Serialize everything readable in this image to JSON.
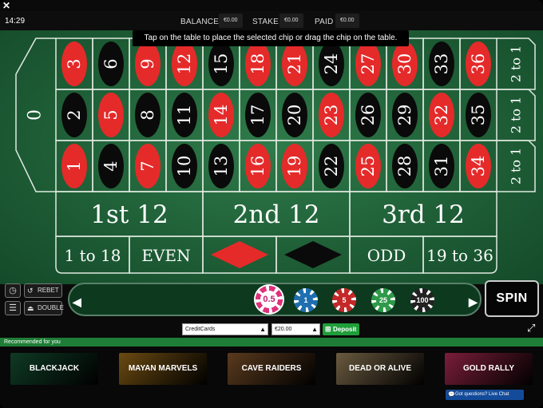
{
  "top_bar": {
    "time": "14:29",
    "balance_label": "BALANCE",
    "balance_value": "€0.00",
    "stake_label": "STAKE",
    "stake_value": "€0.00",
    "paid_label": "PAID",
    "paid_value": "€0.00"
  },
  "message": "Tap on the table to place the selected chip or drag the chip on the table.",
  "table": {
    "zero": "0",
    "numbers": [
      {
        "n": "3",
        "c": "red"
      },
      {
        "n": "6",
        "c": "black"
      },
      {
        "n": "9",
        "c": "red"
      },
      {
        "n": "12",
        "c": "red"
      },
      {
        "n": "15",
        "c": "black"
      },
      {
        "n": "18",
        "c": "red"
      },
      {
        "n": "21",
        "c": "red"
      },
      {
        "n": "24",
        "c": "black"
      },
      {
        "n": "27",
        "c": "red"
      },
      {
        "n": "30",
        "c": "red"
      },
      {
        "n": "33",
        "c": "black"
      },
      {
        "n": "36",
        "c": "red"
      },
      {
        "n": "2",
        "c": "black"
      },
      {
        "n": "5",
        "c": "red"
      },
      {
        "n": "8",
        "c": "black"
      },
      {
        "n": "11",
        "c": "black"
      },
      {
        "n": "14",
        "c": "red"
      },
      {
        "n": "17",
        "c": "black"
      },
      {
        "n": "20",
        "c": "black"
      },
      {
        "n": "23",
        "c": "red"
      },
      {
        "n": "26",
        "c": "black"
      },
      {
        "n": "29",
        "c": "black"
      },
      {
        "n": "32",
        "c": "red"
      },
      {
        "n": "35",
        "c": "black"
      },
      {
        "n": "1",
        "c": "red"
      },
      {
        "n": "4",
        "c": "black"
      },
      {
        "n": "7",
        "c": "red"
      },
      {
        "n": "10",
        "c": "black"
      },
      {
        "n": "13",
        "c": "black"
      },
      {
        "n": "16",
        "c": "red"
      },
      {
        "n": "19",
        "c": "red"
      },
      {
        "n": "22",
        "c": "black"
      },
      {
        "n": "25",
        "c": "red"
      },
      {
        "n": "28",
        "c": "black"
      },
      {
        "n": "31",
        "c": "black"
      },
      {
        "n": "34",
        "c": "red"
      }
    ],
    "column_bets": [
      "2 to 1",
      "2 to 1",
      "2 to 1"
    ],
    "dozens": [
      "1st 12",
      "2nd 12",
      "3rd 12"
    ],
    "outside": [
      "1 to 18",
      "EVEN",
      "RED",
      "BLACK",
      "ODD",
      "19 to 36"
    ]
  },
  "controls": {
    "rebet_label": "REBET",
    "double_label": "DOUBLE",
    "chips": [
      {
        "value": "0.5",
        "color": "#e0307a",
        "selected": true
      },
      {
        "value": "1",
        "color": "#1f6fb0",
        "selected": false
      },
      {
        "value": "5",
        "color": "#c42828",
        "selected": false
      },
      {
        "value": "25",
        "color": "#2e9a4a",
        "selected": false
      },
      {
        "value": "100",
        "color": "#222222",
        "selected": false
      }
    ],
    "spin_label": "SPIN"
  },
  "deposit_bar": {
    "payment_method": "CreditCards",
    "amount": "€20.00",
    "deposit_label": "Deposit"
  },
  "recommended_label": "Recommended for you",
  "games": [
    {
      "name": "BLACKJACK",
      "bg": "#0f3a24"
    },
    {
      "name": "MAYAN MARVELS",
      "bg": "#6b4a12"
    },
    {
      "name": "CAVE RAIDERS",
      "bg": "#5a3a1e"
    },
    {
      "name": "DEAD OR ALIVE",
      "bg": "#6a5a40"
    },
    {
      "name": "GOLD RALLY",
      "bg": "#7a1e3a"
    }
  ],
  "chat_label": "Got questions? Live Chat",
  "colors": {
    "red": "#e52a2a",
    "black": "#0a0a0a",
    "felt": "#2a7040",
    "line": "#dfe9e0"
  }
}
